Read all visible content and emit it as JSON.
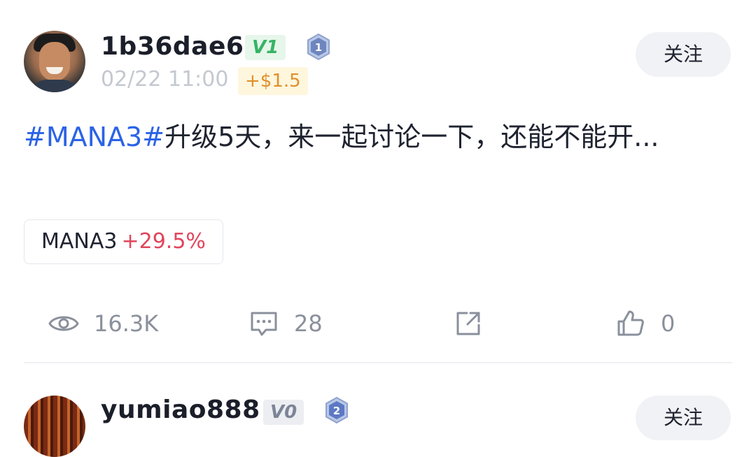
{
  "posts": [
    {
      "username": "1b36dae6",
      "level_badge": "V1",
      "rank_badge": "1",
      "timestamp": "02/22 11:00",
      "tip": "+$1.5",
      "follow_label": "关注",
      "content": {
        "hashtag": "#MANA3#",
        "text": "升级5天，来一起讨论一下，还能不能开..."
      },
      "ticker": {
        "symbol": "MANA3",
        "change": "+29.5%"
      },
      "stats": {
        "views": "16.3K",
        "comments": "28",
        "likes": "0"
      }
    },
    {
      "username": "yumiao888",
      "level_badge": "V0",
      "rank_badge": "2",
      "follow_label": "关注"
    }
  ],
  "colors": {
    "hashtag": "#2b63e6",
    "positive_change": "#e0455c",
    "v1_badge": "#36b366",
    "tip": "#e0902a"
  },
  "icons": [
    "eye-icon",
    "comment-icon",
    "share-icon",
    "thumbs-up-icon",
    "rank-hexagon-icon"
  ]
}
